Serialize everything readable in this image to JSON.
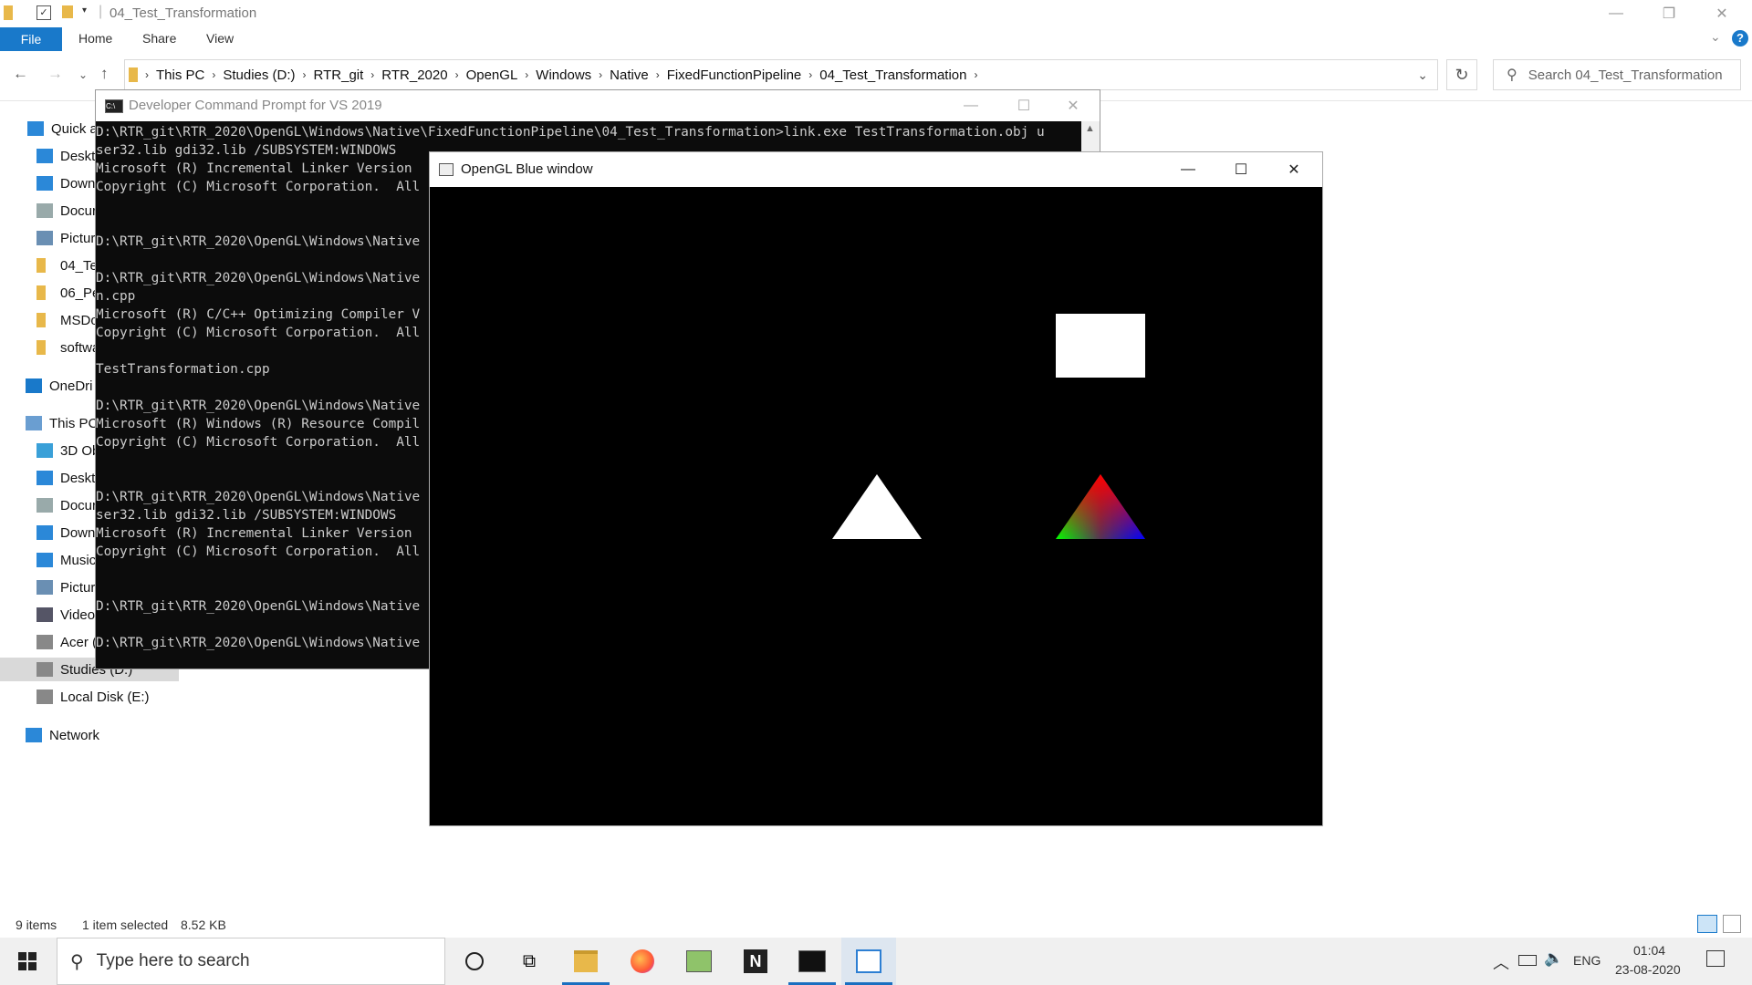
{
  "explorer": {
    "title": "04_Test_Transformation",
    "ribbon_tabs": [
      "File",
      "Home",
      "Share",
      "View"
    ],
    "breadcrumbs": [
      "This PC",
      "Studies (D:)",
      "RTR_git",
      "RTR_2020",
      "OpenGL",
      "Windows",
      "Native",
      "FixedFunctionPipeline",
      "04_Test_Transformation"
    ],
    "search_placeholder": "Search 04_Test_Transformation",
    "sidebar": [
      {
        "label": "Quick a",
        "icon": "star-icon"
      },
      {
        "label": "Deskto",
        "icon": "desktop-icon"
      },
      {
        "label": "Down",
        "icon": "download-icon"
      },
      {
        "label": "Docur",
        "icon": "document-icon"
      },
      {
        "label": "Picture",
        "icon": "picture-icon"
      },
      {
        "label": "04_Tes",
        "icon": "folder-icon"
      },
      {
        "label": "06_Pe",
        "icon": "folder-icon"
      },
      {
        "label": "MSDo",
        "icon": "folder-icon"
      },
      {
        "label": "softwa",
        "icon": "folder-icon"
      },
      {
        "label": "OneDri",
        "icon": "cloud-icon"
      },
      {
        "label": "This PC",
        "icon": "computer-icon"
      },
      {
        "label": "3D Ob",
        "icon": "cube-icon"
      },
      {
        "label": "Deskto",
        "icon": "desktop-icon"
      },
      {
        "label": "Docur",
        "icon": "document-icon"
      },
      {
        "label": "Down",
        "icon": "download-icon"
      },
      {
        "label": "Music",
        "icon": "music-icon"
      },
      {
        "label": "Picture",
        "icon": "picture-icon"
      },
      {
        "label": "Video",
        "icon": "video-icon"
      },
      {
        "label": "Acer (",
        "icon": "drive-icon"
      },
      {
        "label": "Studies (D:)",
        "icon": "drive-icon"
      },
      {
        "label": "Local Disk (E:)",
        "icon": "drive-icon"
      },
      {
        "label": "Network",
        "icon": "network-icon"
      }
    ],
    "status": {
      "items": "9 items",
      "selected": "1 item selected",
      "size": "8.52 KB"
    }
  },
  "cmd": {
    "title": "Developer Command Prompt for VS 2019",
    "lines": [
      "D:\\RTR_git\\RTR_2020\\OpenGL\\Windows\\Native\\FixedFunctionPipeline\\04_Test_Transformation>link.exe TestTransformation.obj u",
      "ser32.lib gdi32.lib /SUBSYSTEM:WINDOWS",
      "Microsoft (R) Incremental Linker Version",
      "Copyright (C) Microsoft Corporation.  All",
      "",
      "",
      "D:\\RTR_git\\RTR_2020\\OpenGL\\Windows\\Native",
      "",
      "D:\\RTR_git\\RTR_2020\\OpenGL\\Windows\\Native",
      "n.cpp",
      "Microsoft (R) C/C++ Optimizing Compiler V",
      "Copyright (C) Microsoft Corporation.  All",
      "",
      "TestTransformation.cpp",
      "",
      "D:\\RTR_git\\RTR_2020\\OpenGL\\Windows\\Native",
      "Microsoft (R) Windows (R) Resource Compil",
      "Copyright (C) Microsoft Corporation.  All",
      "",
      "",
      "D:\\RTR_git\\RTR_2020\\OpenGL\\Windows\\Native",
      "ser32.lib gdi32.lib /SUBSYSTEM:WINDOWS",
      "Microsoft (R) Incremental Linker Version",
      "Copyright (C) Microsoft Corporation.  All",
      "",
      "",
      "D:\\RTR_git\\RTR_2020\\OpenGL\\Windows\\Native",
      "",
      "D:\\RTR_git\\RTR_2020\\OpenGL\\Windows\\Native"
    ]
  },
  "gl_window": {
    "title": "OpenGL Blue window",
    "colors": {
      "background": "#000000",
      "white": "#ffffff",
      "red": "#ff0000",
      "green": "#00ff00",
      "blue": "#0000ff"
    }
  },
  "taskbar": {
    "search_placeholder": "Type here to search",
    "language": "ENG",
    "time": "01:04",
    "date": "23-08-2020",
    "apps": [
      "cortana-icon",
      "task-view-icon",
      "file-explorer-icon",
      "firefox-icon",
      "paint-icon",
      "app-n-icon",
      "terminal-icon",
      "opengl-app-icon"
    ]
  }
}
